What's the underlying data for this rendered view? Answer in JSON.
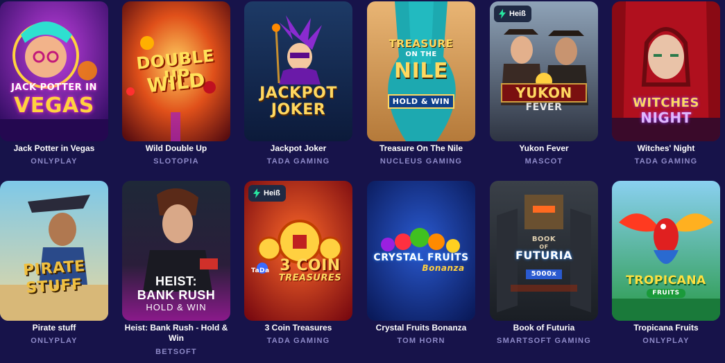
{
  "hot_badge": "Heiß",
  "colors": {
    "background": "#17134a",
    "provider_text": "#8f8bc9",
    "badge_icon": "#27e6a0"
  },
  "games": [
    {
      "title": "Jack Potter in Vegas",
      "provider": "ONLYPLAY",
      "logo_lines": [
        "JACK POTTER IN",
        "VEGAS"
      ],
      "hot": false
    },
    {
      "title": "Wild Double Up",
      "provider": "SLOTOPIA",
      "logo_lines": [
        "DOUBLE UP",
        "WILD"
      ],
      "hot": false
    },
    {
      "title": "Jackpot Joker",
      "provider": "TADA GAMING",
      "logo_lines": [
        "JACKPOT",
        "JOKER"
      ],
      "hot": false
    },
    {
      "title": "Treasure On The Nile",
      "provider": "NUCLEUS GAMING",
      "logo_lines": [
        "TREASURE",
        "ON THE",
        "NILE",
        "HOLD & WIN"
      ],
      "hot": false
    },
    {
      "title": "Yukon Fever",
      "provider": "MASCOT",
      "logo_lines": [
        "YUKON",
        "FEVER"
      ],
      "hot": true
    },
    {
      "title": "Witches' Night",
      "provider": "TADA GAMING",
      "logo_lines": [
        "WITCHES",
        "NIGHT"
      ],
      "hot": false
    },
    {
      "title": "Pirate stuff",
      "provider": "ONLYPLAY",
      "logo_lines": [
        "PIRATE",
        "STUFF"
      ],
      "hot": false
    },
    {
      "title": "Heist: Bank Rush - Hold & Win",
      "provider": "BETSOFT",
      "logo_lines": [
        "HEIST:",
        "BANK RUSH",
        "HOLD & WIN"
      ],
      "hot": false
    },
    {
      "title": "3 Coin Treasures",
      "provider": "TADA GAMING",
      "logo_lines": [
        "3 COIN",
        "TREASURES",
        "TaDa"
      ],
      "hot": true
    },
    {
      "title": "Crystal Fruits Bonanza",
      "provider": "TOM HORN",
      "logo_lines": [
        "CRYSTAL FRUITS",
        "Bonanza"
      ],
      "hot": false
    },
    {
      "title": "Book of Futuria",
      "provider": "SMARTSOFT GAMING",
      "logo_lines": [
        "BOOK",
        "OF",
        "FUTURIA",
        "5000x"
      ],
      "hot": false
    },
    {
      "title": "Tropicana Fruits",
      "provider": "ONLYPLAY",
      "logo_lines": [
        "TROPICANA",
        "FRUITS"
      ],
      "hot": false
    }
  ]
}
